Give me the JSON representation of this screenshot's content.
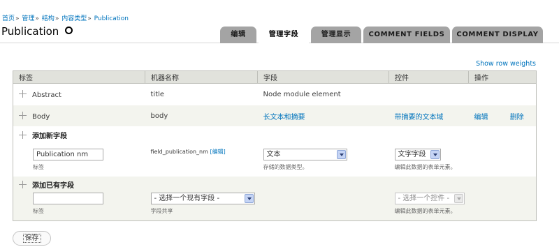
{
  "breadcrumb": {
    "items": [
      "首页",
      "管理",
      "结构",
      "内容类型",
      "Publication"
    ],
    "separator": "»"
  },
  "page": {
    "title": "Publication"
  },
  "tabs": [
    {
      "label": "编辑",
      "active": false
    },
    {
      "label": "管理字段",
      "active": true
    },
    {
      "label": "管理显示",
      "active": false
    },
    {
      "label": "COMMENT FIELDS",
      "active": false
    },
    {
      "label": "COMMENT DISPLAY",
      "active": false
    }
  ],
  "row_weights_link": "Show row weights",
  "table": {
    "headers": [
      "标签",
      "机器名称",
      "字段",
      "控件",
      "操作"
    ],
    "rows": [
      {
        "label": "Abstract",
        "machine_name": "title",
        "field": "Node module element",
        "widget": "",
        "edit": "",
        "delete": ""
      },
      {
        "label": "Body",
        "machine_name": "body",
        "field": "长文本和摘要",
        "widget": "带摘要的文本域",
        "edit": "编辑",
        "delete": "删除"
      }
    ],
    "add_new": {
      "title": "添加新字段",
      "label_value": "Publication nm",
      "label_desc": "标签",
      "machine_name": "field_publication_nm",
      "machine_name_edit": "[编辑]",
      "field_type": "文本",
      "field_type_desc": "存储的数据类型。",
      "widget": "文字字段",
      "widget_desc": "编辑此数据的表单元素。"
    },
    "add_existing": {
      "title": "添加已有字段",
      "label_value": "",
      "label_desc": "标签",
      "field_select": "- 选择一个现有字段 -",
      "field_desc": "字段共享",
      "widget": "- 选择一个控件 -",
      "widget_desc": "编辑此数据的表单元素。"
    }
  },
  "save_label": "保存",
  "colors": {
    "link": "#0074bd",
    "tab_inactive": "#a4a4a4",
    "header_bg": "#e1e2dc",
    "row_alt_bg": "#f3f4ee"
  }
}
